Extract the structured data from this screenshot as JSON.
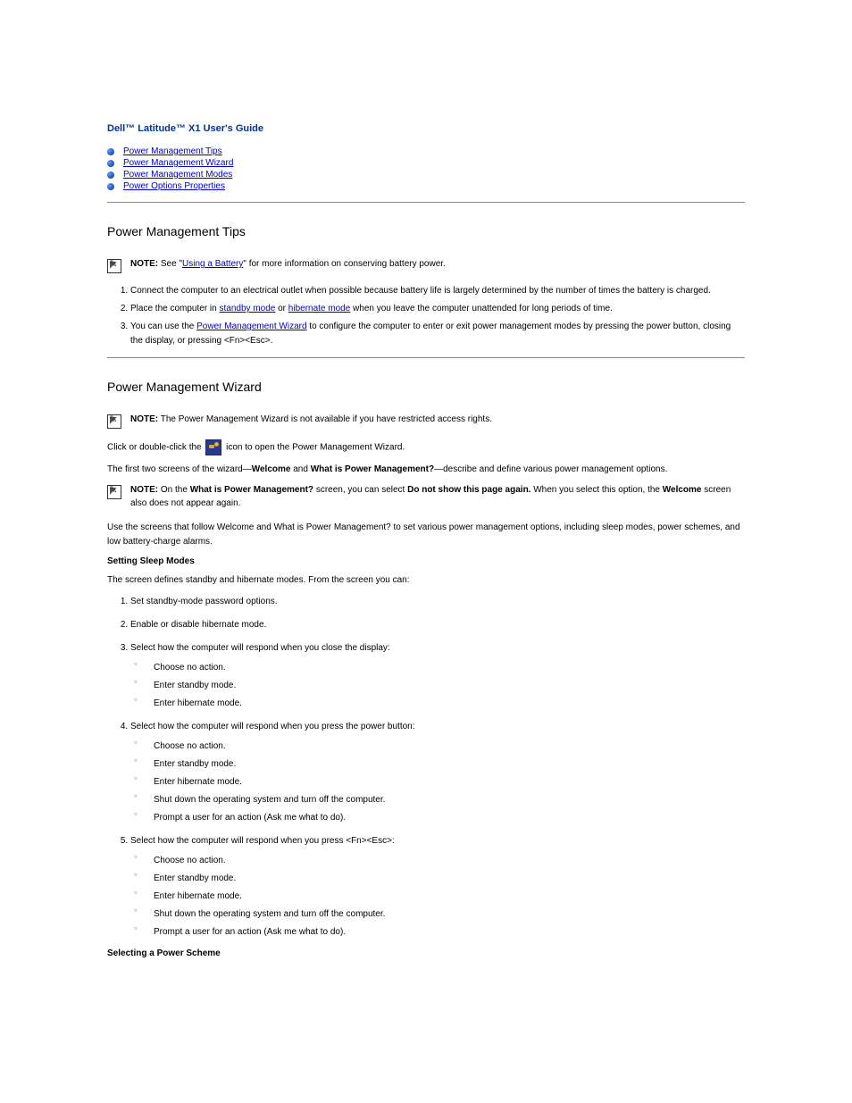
{
  "subtitle": "Dell™ Latitude™ X1 User's Guide",
  "toc": [
    {
      "label": "Power Management Tips",
      "href": "#tips"
    },
    {
      "label": "Power Management Wizard",
      "href": "#wizard"
    },
    {
      "label": "Power Management Modes",
      "href": "#modes"
    },
    {
      "label": "Power Options Properties",
      "href": "#props"
    }
  ],
  "sec1": {
    "heading": "Power Management Tips",
    "note_label": "NOTE:",
    "note_text_a": " See \"",
    "note_link": "Using a Battery",
    "note_text_b": "\" for more information on conserving battery power.",
    "steps": [
      {
        "text": "Connect the computer to an electrical outlet when possible because battery life is largely determined by the number of times the battery is charged."
      },
      {
        "text_a": "Place the computer in ",
        "link1": "standby mode",
        "text_b": " or ",
        "link2": "hibernate mode",
        "text_c": " when you leave the computer unattended for long periods of time."
      },
      {
        "text_a": "You can use the ",
        "link1": "Power Management Wizard",
        "text_b": " to configure the computer to enter or exit power management modes by pressing the power button, closing the display, or pressing <Fn><Esc>."
      }
    ]
  },
  "sec2": {
    "heading": "Power Management Wizard",
    "note1_label": "NOTE:",
    "note1_text": " The Power Management Wizard is not available if you have restricted access rights.",
    "para_a": "Click or double-click the ",
    "para_b": " icon to open the Power Management Wizard.",
    "para2_a": "The first two screens of the wizard—",
    "para2_b": "Welcome",
    "para2_c": " and ",
    "para2_d": "What is Power Management?",
    "para2_e": "—describe and define various power management options.",
    "note2_label": "NOTE:",
    "note2_text_a": " On the ",
    "note2_b": "What is Power Management?",
    "note2_text_b": " screen, you can select ",
    "note2_c": "Do not show this page again.",
    "note2_text_c": " When you select this option, the ",
    "note2_d": "Welcome",
    "note2_text_d": " screen also does not appear again.",
    "para3": "Use the screens that follow Welcome and What is Power Management? to set various power management options, including sleep modes, power schemes, and low battery-charge alarms.",
    "sub1_heading": "Setting Sleep Modes",
    "sub1_para": "The screen defines standby and hibernate modes. From the screen you can:",
    "sub1_items": [
      "Set standby-mode password options.",
      "Enable or disable hibernate mode.",
      "Select how the computer will respond when you close the display:",
      "Select how the computer will respond when you press the power button:",
      "Select how the computer will respond when you press <Fn><Esc>:"
    ],
    "sub1_group1": [
      "Choose no action.",
      "Enter standby mode.",
      "Enter hibernate mode."
    ],
    "sub1_group2": [
      "Choose no action.",
      "Enter standby mode.",
      "Enter hibernate mode.",
      "Shut down the operating system and turn off the computer.",
      "Prompt a user for an action (Ask me what to do)."
    ],
    "sub1_group3": [
      "Choose no action.",
      "Enter standby mode.",
      "Enter hibernate mode.",
      "Shut down the operating system and turn off the computer.",
      "Prompt a user for an action (Ask me what to do)."
    ],
    "sub2_heading": "Selecting a Power Scheme"
  }
}
